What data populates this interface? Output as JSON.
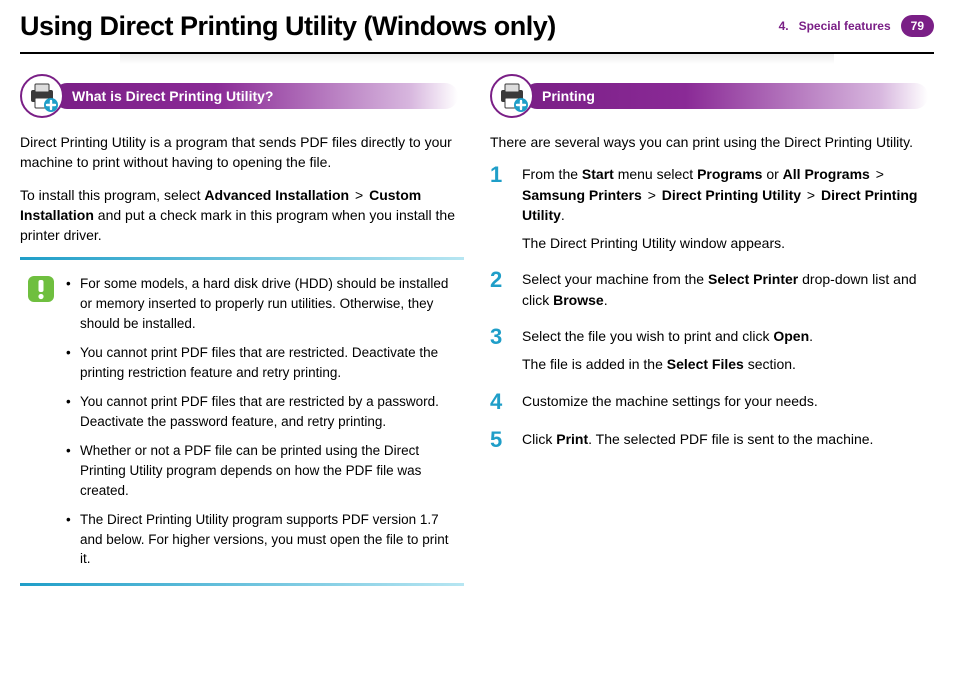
{
  "header": {
    "title": "Using Direct Printing Utility (Windows only)",
    "chapter_num": "4.",
    "chapter_name": "Special features",
    "page_number": "79"
  },
  "left": {
    "section_title": "What is Direct Printing Utility?",
    "intro": "Direct Printing Utility is a program that sends PDF files directly to your machine to print without having to opening the file.",
    "install_pre": "To install this program, select ",
    "install_b1": "Advanced Installation",
    "install_gt1": " > ",
    "install_b2": "Custom Installation",
    "install_post": " and put a check mark in this program when you install the printer driver.",
    "notes": [
      "For some models,  a hard disk drive (HDD) should be installed or memory inserted to properly run utilities. Otherwise, they should be installed.",
      "You cannot print PDF files that are restricted. Deactivate the printing restriction feature and retry printing.",
      "You cannot print PDF files that are restricted by a password. Deactivate the password feature, and retry printing.",
      "Whether or not a PDF file can be printed using the Direct Printing Utility program depends on how the PDF file was created.",
      "The Direct Printing Utility program supports PDF version 1.7 and below. For higher versions, you must open the file to print it."
    ]
  },
  "right": {
    "section_title": "Printing",
    "intro": "There are several ways you can print using the Direct Printing Utility.",
    "steps": {
      "s1": {
        "pre": "From the ",
        "b1": "Start",
        "t1": " menu select ",
        "b2": "Programs",
        "t2": " or ",
        "b3": "All Programs",
        "gt1": " > ",
        "b4": "Samsung Printers",
        "gt2": " > ",
        "b5": "Direct Printing Utility",
        "gt3": " > ",
        "b6": "Direct Printing Utility",
        "post": ".",
        "sub": "The Direct Printing Utility window appears."
      },
      "s2": {
        "pre": "Select your machine from the ",
        "b1": "Select Printer",
        "t1": " drop-down list and click ",
        "b2": "Browse",
        "post": "."
      },
      "s3": {
        "pre": "Select the file you wish to print and click ",
        "b1": "Open",
        "post": ".",
        "sub_pre": "The file is added in the ",
        "sub_b1": "Select Files",
        "sub_post": " section."
      },
      "s4": {
        "text": "Customize the machine settings for your needs."
      },
      "s5": {
        "pre": "Click ",
        "b1": "Print",
        "post": ". The selected PDF file is sent to the machine."
      }
    }
  }
}
